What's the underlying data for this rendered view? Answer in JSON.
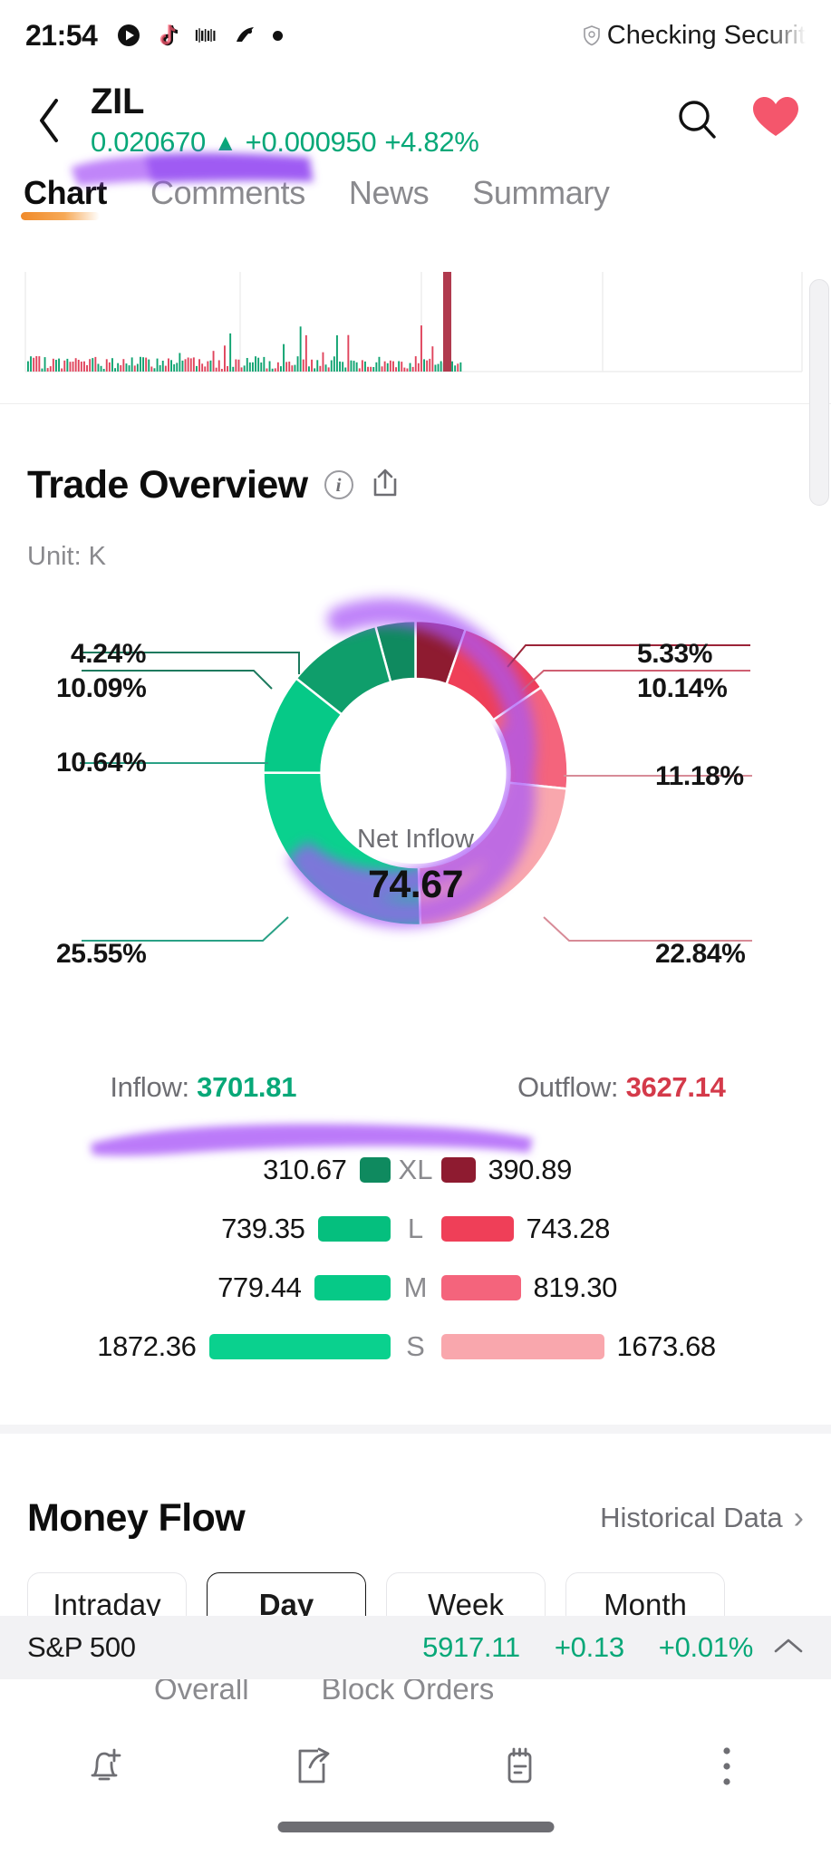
{
  "status_bar": {
    "time": "21:54",
    "icons": [
      "play-store-icon",
      "tiktok-icon",
      "trust-wallet-icon",
      "app-icon",
      "dot-badge"
    ],
    "right_label": "Checking Securit",
    "right_icon": "shield-icon"
  },
  "header": {
    "back_icon": "chevron-left-icon",
    "symbol": "ZIL",
    "price": "0.020670",
    "arrow": "▲",
    "change": "+0.000950",
    "change_pct": "+4.82%",
    "search_icon": "search-icon",
    "favorite_icon": "heart-icon"
  },
  "tabs": [
    {
      "label": "Chart",
      "active": true
    },
    {
      "label": "Comments",
      "active": false
    },
    {
      "label": "News",
      "active": false
    },
    {
      "label": "Summary",
      "active": false
    }
  ],
  "trade_overview": {
    "title": "Trade Overview",
    "info_icon": "info-icon",
    "share_icon": "share-icon",
    "unit": "Unit: K",
    "center_caption": "Net Inflow",
    "center_value": "74.67",
    "inflow_label": "Inflow:",
    "inflow_value": "3701.81",
    "outflow_label": "Outflow:",
    "outflow_value": "3627.14",
    "rows": [
      {
        "size": "XL",
        "in": "310.67",
        "out": "390.89",
        "in_color": "#0f8a5f",
        "out_color": "#8e1b30",
        "in_w": 34,
        "out_w": 38
      },
      {
        "size": "L",
        "in": "739.35",
        "out": "743.28",
        "in_color": "#05bf7e",
        "out_color": "#ef3f58",
        "in_w": 80,
        "out_w": 80
      },
      {
        "size": "M",
        "in": "779.44",
        "out": "819.30",
        "in_color": "#06c987",
        "out_color": "#f4647c",
        "in_w": 84,
        "out_w": 88
      },
      {
        "size": "S",
        "in": "1872.36",
        "out": "1673.68",
        "in_color": "#0ad18e",
        "out_color": "#f9a7ad",
        "in_w": 200,
        "out_w": 180
      }
    ]
  },
  "chart_data": {
    "type": "pie",
    "title": "Trade Overview",
    "subtitle": "Unit: K",
    "center_label": "Net Inflow",
    "center_value": 74.67,
    "unit": "K",
    "legend_position": "sides",
    "labels_outside": true,
    "series": [
      {
        "name": "Inflow",
        "total": 3701.81,
        "slices": [
          {
            "name": "XL",
            "value": 310.67,
            "percent": 4.24,
            "color": "#0f8a5f"
          },
          {
            "name": "L",
            "value": 739.35,
            "percent": 10.09,
            "color": "#0f9e6b"
          },
          {
            "name": "M",
            "value": 779.44,
            "percent": 10.64,
            "color": "#06c987"
          },
          {
            "name": "S",
            "value": 1872.36,
            "percent": 25.55,
            "color": "#0ad18e"
          }
        ]
      },
      {
        "name": "Outflow",
        "total": 3627.14,
        "slices": [
          {
            "name": "XL",
            "value": 390.89,
            "percent": 5.33,
            "color": "#8e1b30"
          },
          {
            "name": "L",
            "value": 743.28,
            "percent": 10.14,
            "color": "#ef3f58"
          },
          {
            "name": "M",
            "value": 819.3,
            "percent": 11.18,
            "color": "#f4647c"
          },
          {
            "name": "S",
            "value": 1673.68,
            "percent": 22.84,
            "color": "#f9a7ad"
          }
        ]
      }
    ],
    "outer_labels_left": [
      "4.24%",
      "10.09%",
      "10.64%",
      "25.55%"
    ],
    "outer_labels_right": [
      "5.33%",
      "10.14%",
      "11.18%",
      "22.84%"
    ]
  },
  "volume_strip": {
    "type": "bar",
    "name": "volume-histogram",
    "up_color": "#10a371",
    "down_color": "#e0445c"
  },
  "money_flow": {
    "title": "Money Flow",
    "historical_link": "Historical Data",
    "chevron_icon": "chevron-right-icon",
    "segments": [
      {
        "label": "Intraday",
        "active": false
      },
      {
        "label": "Day",
        "active": true
      },
      {
        "label": "Week",
        "active": false
      },
      {
        "label": "Month",
        "active": false
      }
    ],
    "subtabs": [
      {
        "label": "Overall"
      },
      {
        "label": "Block Orders"
      }
    ]
  },
  "ticker_bar": {
    "name": "S&P 500",
    "value": "5917.11",
    "change": "+0.13",
    "change_pct": "+0.01%",
    "caret_icon": "chevron-up-icon"
  },
  "bottom_nav": [
    {
      "name": "alert-bell-icon"
    },
    {
      "name": "share-icon"
    },
    {
      "name": "notes-icon"
    },
    {
      "name": "more-vertical-icon"
    }
  ],
  "colors": {
    "up_green": "#07a878",
    "down_red": "#d43a4a",
    "accent_orange": "#f08a2a",
    "heart_pink": "#f4566c",
    "highlighter_purple": "#a855f7"
  }
}
